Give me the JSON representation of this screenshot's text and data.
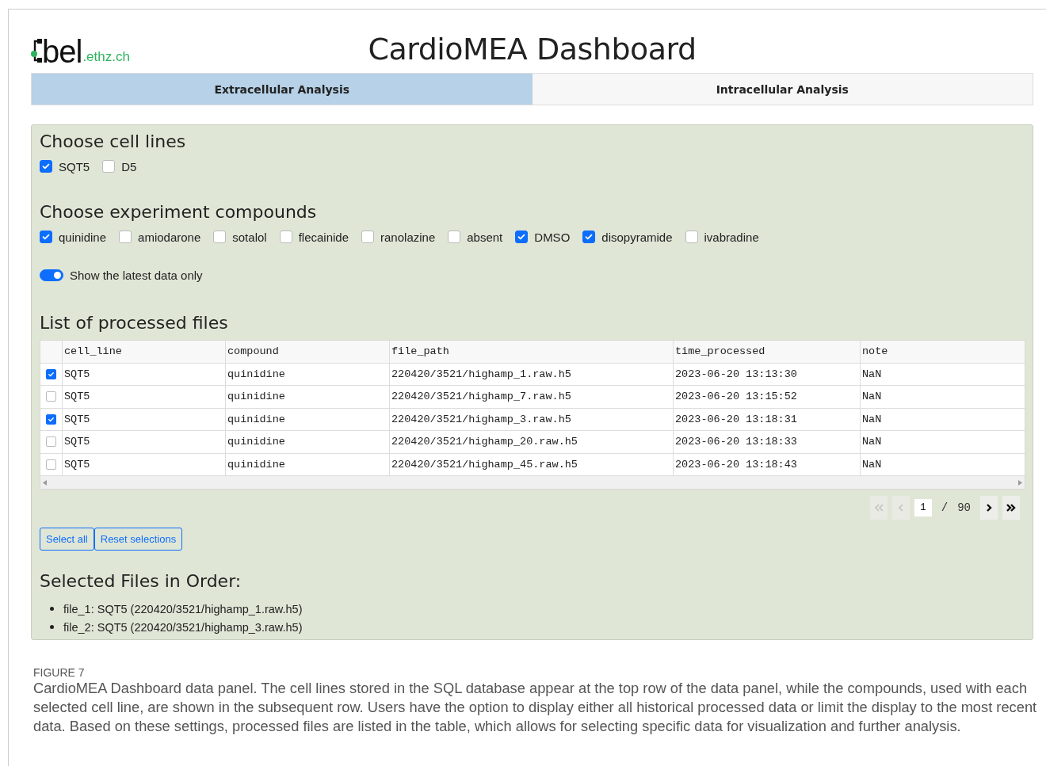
{
  "header": {
    "logo": {
      "main": "bel",
      "domain": ".ethz.ch"
    },
    "title": "CardioMEA Dashboard"
  },
  "tabs": [
    {
      "label": "Extracellular Analysis",
      "selected": true
    },
    {
      "label": "Intracellular Analysis",
      "selected": false
    }
  ],
  "cell_lines": {
    "heading": "Choose cell lines",
    "options": [
      {
        "label": "SQT5",
        "checked": true
      },
      {
        "label": "D5",
        "checked": false
      }
    ]
  },
  "compounds": {
    "heading": "Choose experiment compounds",
    "options": [
      {
        "label": "quinidine",
        "checked": true
      },
      {
        "label": "amiodarone",
        "checked": false
      },
      {
        "label": "sotalol",
        "checked": false
      },
      {
        "label": "flecainide",
        "checked": false
      },
      {
        "label": "ranolazine",
        "checked": false
      },
      {
        "label": "absent",
        "checked": false
      },
      {
        "label": "DMSO",
        "checked": true
      },
      {
        "label": "disopyramide",
        "checked": true
      },
      {
        "label": "ivabradine",
        "checked": false
      }
    ]
  },
  "latest_toggle": {
    "label": "Show the latest data only",
    "on": true
  },
  "files": {
    "heading": "List of processed files",
    "columns": [
      "cell_line",
      "compound",
      "file_path",
      "time_processed",
      "note"
    ],
    "rows": [
      {
        "selected": true,
        "cells": [
          "SQT5",
          "quinidine",
          "220420/3521/highamp_1.raw.h5",
          "2023-06-20 13:13:30",
          "NaN"
        ]
      },
      {
        "selected": false,
        "cells": [
          "SQT5",
          "quinidine",
          "220420/3521/highamp_7.raw.h5",
          "2023-06-20 13:15:52",
          "NaN"
        ]
      },
      {
        "selected": true,
        "cells": [
          "SQT5",
          "quinidine",
          "220420/3521/highamp_3.raw.h5",
          "2023-06-20 13:18:31",
          "NaN"
        ]
      },
      {
        "selected": false,
        "cells": [
          "SQT5",
          "quinidine",
          "220420/3521/highamp_20.raw.h5",
          "2023-06-20 13:18:33",
          "NaN"
        ]
      },
      {
        "selected": false,
        "cells": [
          "SQT5",
          "quinidine",
          "220420/3521/highamp_45.raw.h5",
          "2023-06-20 13:18:43",
          "NaN"
        ]
      }
    ],
    "pagination": {
      "page": "1",
      "separator": "/",
      "total": "90",
      "buttons": [
        {
          "kind": "first",
          "disabled": true
        },
        {
          "kind": "previous",
          "disabled": true
        },
        {
          "kind": "next",
          "disabled": false
        },
        {
          "kind": "last",
          "disabled": false
        }
      ]
    }
  },
  "buttons": [
    "Select all",
    "Reset selections"
  ],
  "selected_files": {
    "heading": "Selected Files in Order:",
    "items": [
      "file_1: SQT5 (220420/3521/highamp_1.raw.h5)",
      "file_2: SQT5 (220420/3521/highamp_3.raw.h5)"
    ]
  },
  "caption": {
    "label": "FIGURE 7",
    "text": "CardioMEA Dashboard data panel. The cell lines stored in the SQL database appear at the top row of the data panel, while the compounds, used with each selected cell line, are shown in the subsequent row. Users have the option to display either all historical processed data or limit the display to the most recent data. Based on these settings, processed files are listed in the table, which allows for selecting specific data for visualization and further analysis."
  }
}
